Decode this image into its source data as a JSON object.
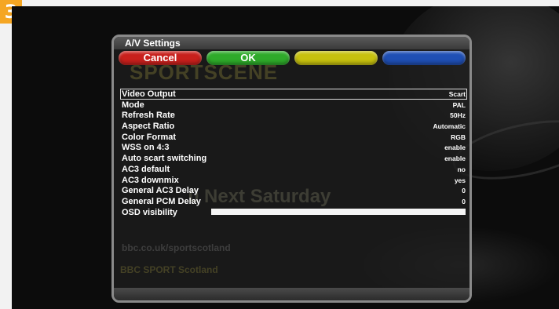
{
  "badge": "3",
  "panel": {
    "title": "A/V Settings",
    "buttons": {
      "red": "Cancel",
      "green": "OK",
      "yellow": "",
      "blue": ""
    }
  },
  "background": {
    "line1": "SPORTSCENE",
    "line2": "0 Next Saturday",
    "line3": "bbc.co.uk/sportscotland",
    "line4": "BBC SPORT Scotland"
  },
  "settings": [
    {
      "label": "Video Output",
      "value": "Scart",
      "selected": true
    },
    {
      "label": "Mode",
      "value": "PAL"
    },
    {
      "label": "Refresh Rate",
      "value": "50Hz"
    },
    {
      "label": "Aspect Ratio",
      "value": "Automatic"
    },
    {
      "label": "Color Format",
      "value": "RGB"
    },
    {
      "label": "WSS on 4:3",
      "value": "enable"
    },
    {
      "label": "Auto scart switching",
      "value": "enable"
    },
    {
      "label": "AC3 default",
      "value": "no"
    },
    {
      "label": "AC3 downmix",
      "value": "yes"
    },
    {
      "label": "General AC3 Delay",
      "value": "0"
    },
    {
      "label": "General PCM Delay",
      "value": "0"
    },
    {
      "label": "OSD visibility",
      "value": "",
      "slider_level": 1.0
    }
  ],
  "colors": {
    "badge": "#f5a623",
    "red_button": "#c8201c",
    "green_button": "#2eaa2a",
    "yellow_button": "#c7c10e",
    "blue_button": "#1f4fb4"
  }
}
